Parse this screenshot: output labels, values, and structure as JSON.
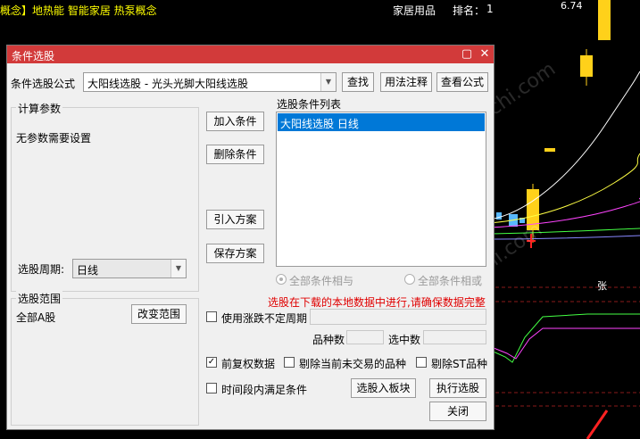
{
  "background": {
    "concept_bar": "概念】地热能 智能家居 热泵概念",
    "industry": "家居用品",
    "rank_label": "排名：",
    "rank_value": "1",
    "price_label": "6.74",
    "zhang_tag": "张",
    "watermark": "www.cfchi.com"
  },
  "dialog": {
    "title": "条件选股",
    "formula_label": "条件选股公式",
    "formula_value": "大阳线选股  - 光头光脚大阳线选股",
    "find_button": "查找",
    "usage_button": "用法注释",
    "view_formula_button": "查看公式",
    "params_group": "计算参数",
    "params_text": "无参数需要设置",
    "period_label": "选股周期:",
    "period_value": "日线",
    "range_group": "选股范围",
    "range_value": "全部A股",
    "change_range_button": "改变范围",
    "add_condition_button": "加入条件",
    "delete_condition_button": "删除条件",
    "import_plan_button": "引入方案",
    "save_plan_button": "保存方案",
    "condition_list_label": "选股条件列表",
    "condition_list": [
      "大阳线选股  日线"
    ],
    "radio_and": "全部条件相与",
    "radio_or": "全部条件相或",
    "warning": "选股在下载的本地数据中进行,请确保数据完整",
    "uncertain_period_label": "使用涨跌不定周期",
    "count_label": "品种数",
    "selected_label": "选中数",
    "forward_adjust_label": "前复权数据",
    "forward_adjust_checked": true,
    "exclude_untraded_label": "剔除当前未交易的品种",
    "exclude_st_label": "剔除ST品种",
    "time_range_label": "时间段内满足条件",
    "to_block_button": "选股入板块",
    "execute_button": "执行选股",
    "close_button": "关闭"
  },
  "colors": {
    "title_bar": "#d23a3a",
    "selection": "#0078d7",
    "warning": "#e00000",
    "concept_text": "#ffff00"
  }
}
